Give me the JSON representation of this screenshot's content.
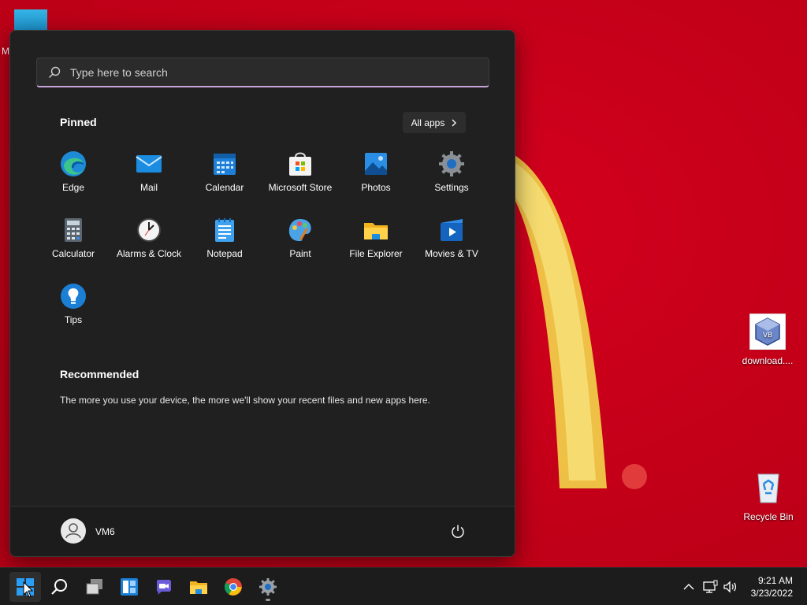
{
  "desktop": {
    "partial_icon_label": "M",
    "icons": [
      {
        "label": "download...."
      },
      {
        "label": "Recycle Bin"
      }
    ]
  },
  "start_menu": {
    "search_placeholder": "Type here to search",
    "pinned_title": "Pinned",
    "all_apps_label": "All apps",
    "pinned_apps": [
      {
        "label": "Edge",
        "icon": "edge-icon"
      },
      {
        "label": "Mail",
        "icon": "mail-icon"
      },
      {
        "label": "Calendar",
        "icon": "calendar-icon"
      },
      {
        "label": "Microsoft Store",
        "icon": "store-icon"
      },
      {
        "label": "Photos",
        "icon": "photos-icon"
      },
      {
        "label": "Settings",
        "icon": "gear-icon"
      },
      {
        "label": "Calculator",
        "icon": "calculator-icon"
      },
      {
        "label": "Alarms & Clock",
        "icon": "clock-icon"
      },
      {
        "label": "Notepad",
        "icon": "notepad-icon"
      },
      {
        "label": "Paint",
        "icon": "paint-icon"
      },
      {
        "label": "File Explorer",
        "icon": "folder-icon"
      },
      {
        "label": "Movies & TV",
        "icon": "movies-icon"
      },
      {
        "label": "Tips",
        "icon": "tips-icon"
      }
    ],
    "recommended_title": "Recommended",
    "recommended_text": "The more you use your device, the more we'll show your recent files and new apps here.",
    "user_name": "VM6"
  },
  "taskbar": {
    "apps": [
      "start-icon",
      "search-icon",
      "task-view-icon",
      "widgets-icon",
      "chat-icon",
      "folder-icon",
      "chrome-icon",
      "gear-icon"
    ],
    "clock_time": "9:21 AM",
    "clock_date": "3/23/2022"
  },
  "colors": {
    "wallpaper": "#c8001a",
    "start_bg": "#202020",
    "accent": "#0078d4",
    "search_underline": "#c9a3d9"
  }
}
